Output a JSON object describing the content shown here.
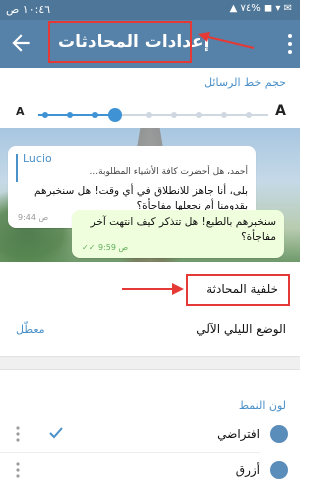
{
  "status_bar": {
    "time": "١٠:٤٦ ص",
    "icons": "▲ ٧٤% ◼ ▾ ✉"
  },
  "app_bar": {
    "title": "إعدادات المحادثات",
    "back_icon": "arrow-left",
    "menu_icon": "more-vertical"
  },
  "text_size": {
    "header": "حجم خط الرسائل",
    "small_label": "A",
    "large_label": "A",
    "value_fraction": 0.36
  },
  "preview": {
    "incoming": {
      "reply_name": "Lucio",
      "reply_text": "أحمد، هل أحضرت كافة الأشياء المطلوبة...",
      "text": "بلى، أنا جاهز للانطلاق في أي وقت! هل سنخبرهم بقدومنا أم نجعلها مفاجأة؟",
      "time": "9:44 ص"
    },
    "outgoing": {
      "text": "سنخبرهم بالطبع! هل تتذكر كيف انتهت آخر مفاجأة؟",
      "time": "9:59 ص"
    }
  },
  "settings": {
    "chat_background": "خلفية المحادثة",
    "night_mode_label": "الوضع الليلي الآلي",
    "night_mode_value": "معطّل"
  },
  "theme": {
    "header": "لون النمط",
    "items": [
      {
        "label": "افتراضي",
        "selected": true,
        "color": "#5a8db9"
      },
      {
        "label": "أزرق",
        "selected": false,
        "color": "#5a8db9"
      }
    ]
  },
  "colors": {
    "accent": "#4a90c9",
    "app_bar": "#5681a8",
    "highlight": "#e53935"
  }
}
